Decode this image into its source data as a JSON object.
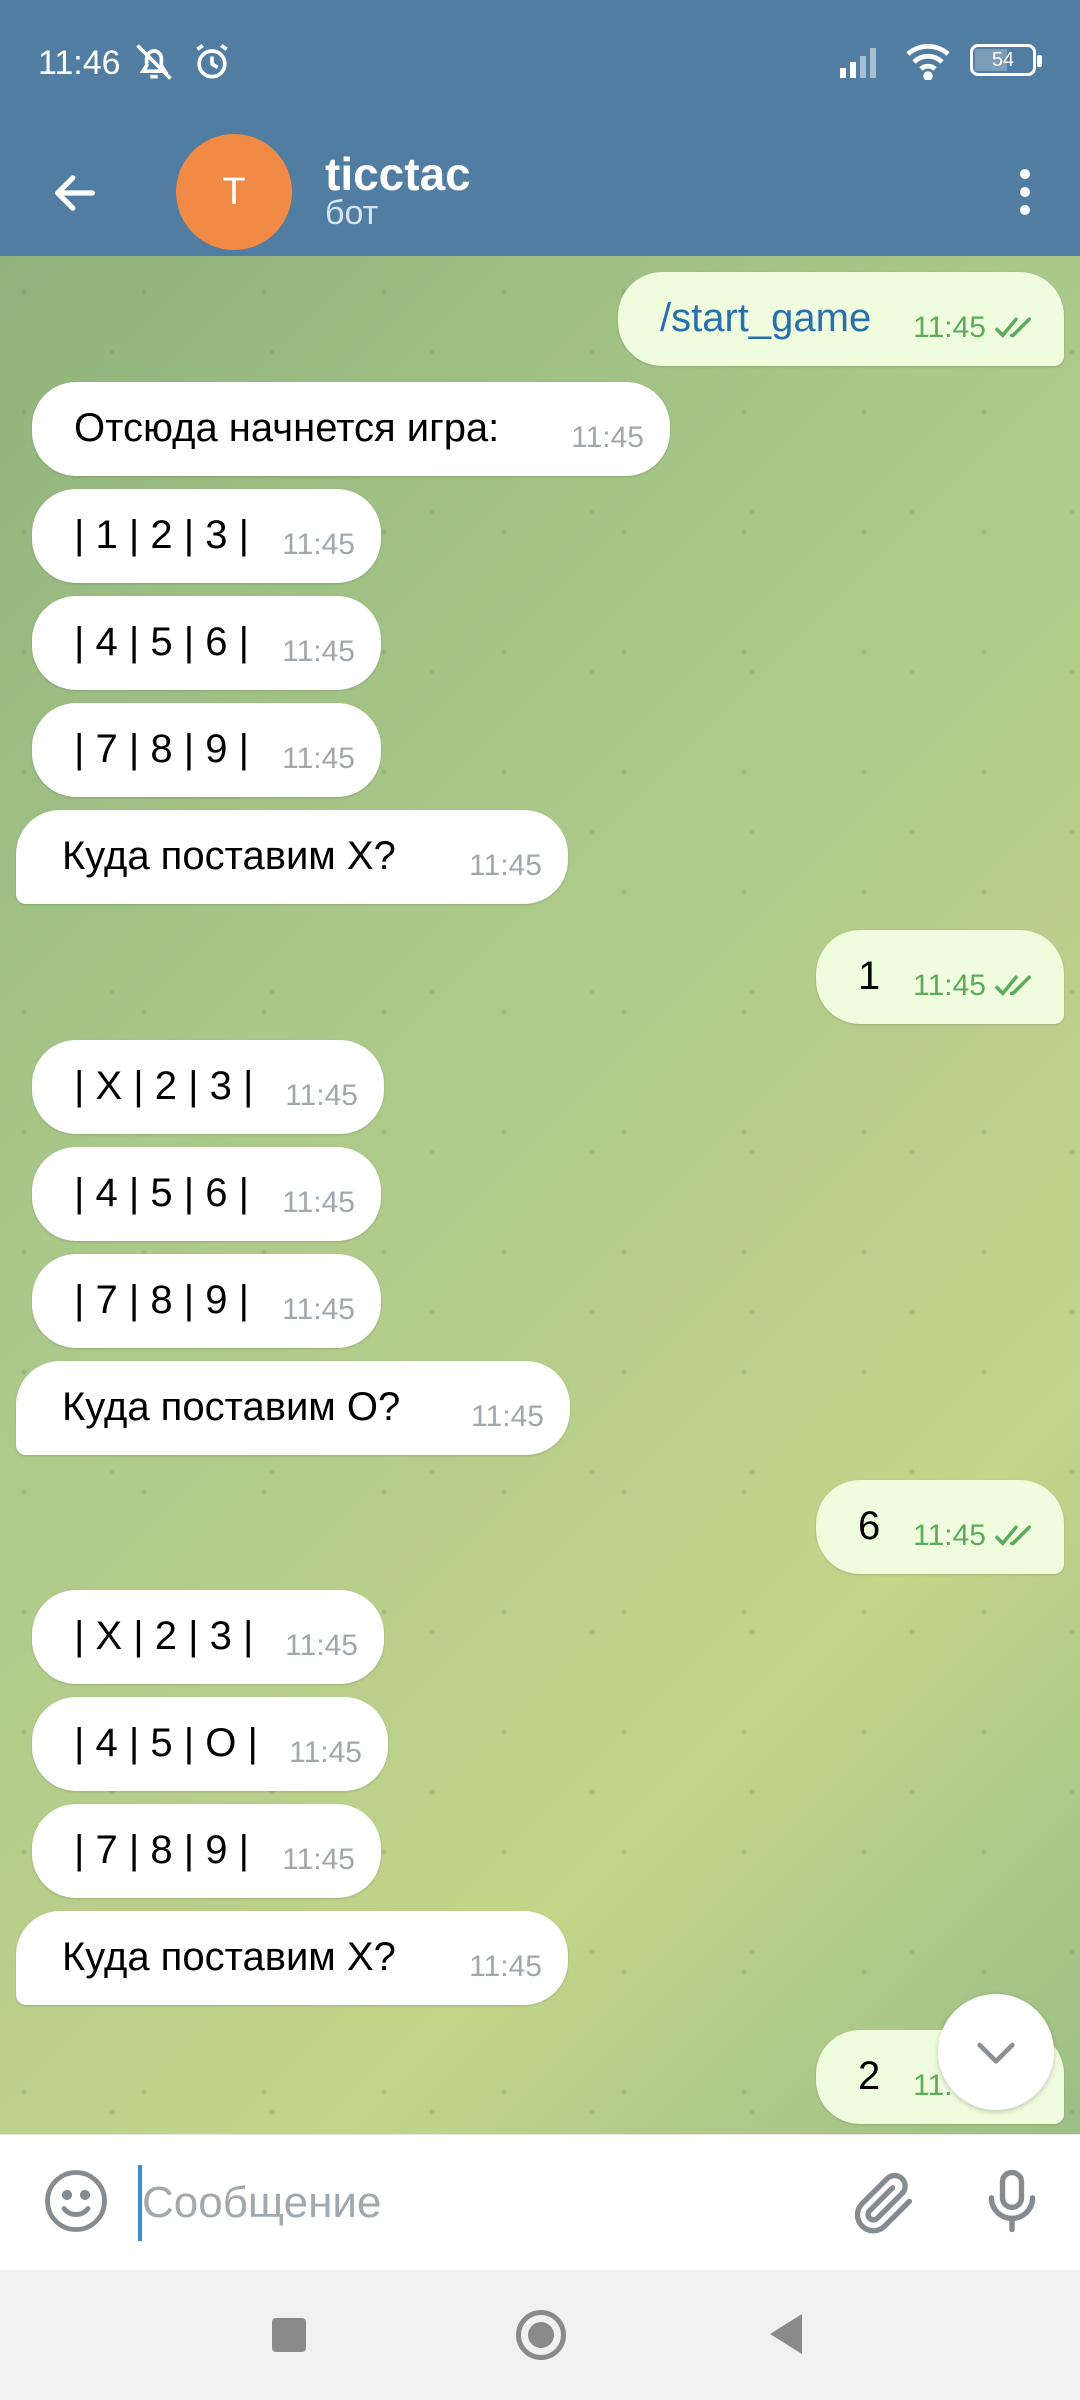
{
  "status_bar": {
    "time": "11:46",
    "battery": "54"
  },
  "header": {
    "avatar_letter": "T",
    "title": "ticctac",
    "subtitle": "бот",
    "avatar_color": "#f08a44",
    "bar_color": "#517da2"
  },
  "messages": [
    {
      "dir": "out",
      "text": "/start_game",
      "time": "11:45"
    },
    {
      "dir": "in",
      "text": "Отсюда начнется игра:",
      "time": "11:45"
    },
    {
      "dir": "in",
      "text": "| 1 | 2 | 3 |",
      "time": "11:45"
    },
    {
      "dir": "in",
      "text": "| 4 | 5 | 6 |",
      "time": "11:45"
    },
    {
      "dir": "in",
      "text": "| 7 | 8 | 9 |",
      "time": "11:45"
    },
    {
      "dir": "in",
      "text": "Куда поставим X?",
      "time": "11:45"
    },
    {
      "dir": "out",
      "text": "1",
      "time": "11:45"
    },
    {
      "dir": "in",
      "text": "| X | 2 | 3 |",
      "time": "11:45"
    },
    {
      "dir": "in",
      "text": "| 4 | 5 | 6 |",
      "time": "11:45"
    },
    {
      "dir": "in",
      "text": "| 7 | 8 | 9 |",
      "time": "11:45"
    },
    {
      "dir": "in",
      "text": "Куда поставим O?",
      "time": "11:45"
    },
    {
      "dir": "out",
      "text": "6",
      "time": "11:45"
    },
    {
      "dir": "in",
      "text": "| X | 2 | 3 |",
      "time": "11:45"
    },
    {
      "dir": "in",
      "text": "| 4 | 5 | O |",
      "time": "11:45"
    },
    {
      "dir": "in",
      "text": "| 7 | 8 | 9 |",
      "time": "11:45"
    },
    {
      "dir": "in",
      "text": "Куда поставим X?",
      "time": "11:45"
    },
    {
      "dir": "out",
      "text": "2",
      "time": "11:45"
    }
  ],
  "input": {
    "placeholder": "Сообщение"
  },
  "icons": {
    "back": "arrow-left-icon",
    "menu": "more-vertical-icon",
    "emoji": "smile-icon",
    "attach": "paperclip-icon",
    "mic": "microphone-icon",
    "read": "double-check-icon",
    "scroll": "chevron-down-icon"
  }
}
